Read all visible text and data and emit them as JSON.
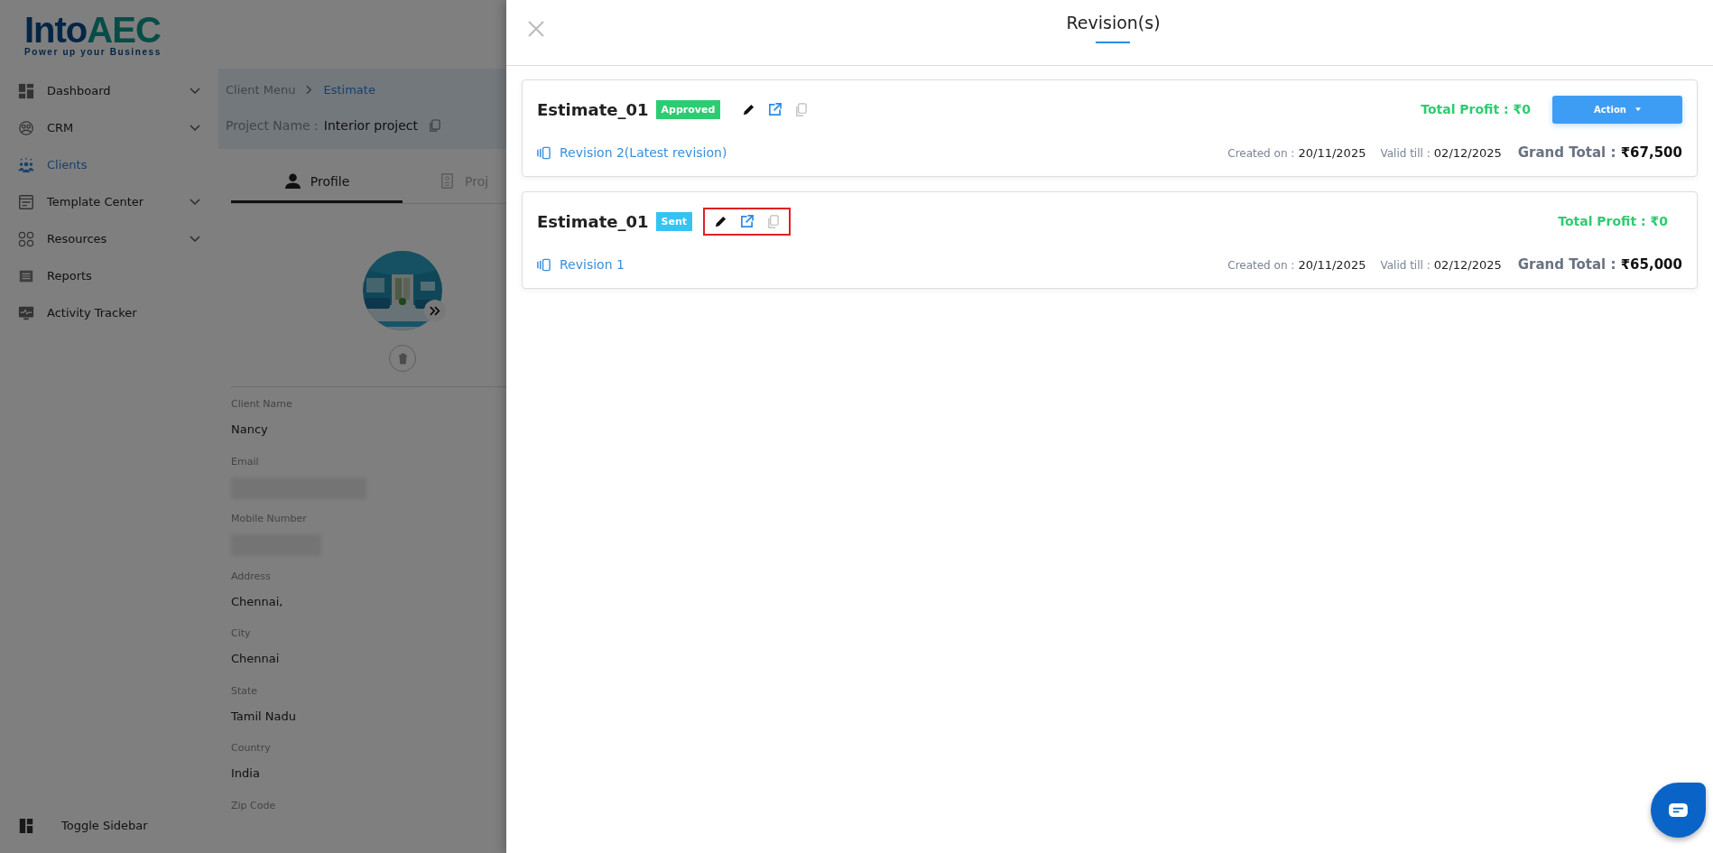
{
  "logo": {
    "name_main": "Into",
    "name_accent": "AEC",
    "tagline": "Power up your Business"
  },
  "sidebar": {
    "items": [
      {
        "label": "Dashboard",
        "expandable": true,
        "selected": false
      },
      {
        "label": "CRM",
        "expandable": true,
        "selected": false
      },
      {
        "label": "Clients",
        "expandable": false,
        "selected": true
      },
      {
        "label": "Template Center",
        "expandable": true,
        "selected": false
      },
      {
        "label": "Resources",
        "expandable": true,
        "selected": false
      },
      {
        "label": "Reports",
        "expandable": false,
        "selected": false
      },
      {
        "label": "Activity Tracker",
        "expandable": false,
        "selected": false
      }
    ],
    "toggle": "Toggle Sidebar"
  },
  "breadcrumb": [
    "Client Menu",
    "Estimate"
  ],
  "project": {
    "label": "Project Name :",
    "value": "Interior project"
  },
  "tabs": [
    {
      "label": "Profile",
      "selected": true
    },
    {
      "label": "Proj",
      "selected": false
    }
  ],
  "profile_fields": [
    {
      "label": "Client Name",
      "value": "Nancy",
      "kind": "text"
    },
    {
      "label": "Email",
      "kind": "redacted"
    },
    {
      "label": "Mobile Number",
      "kind": "redacted"
    },
    {
      "label": "Address",
      "value": "Chennai,",
      "kind": "text"
    },
    {
      "label": "City",
      "value": "Chennai",
      "kind": "text"
    },
    {
      "label": "State",
      "value": "Tamil Nadu",
      "kind": "text"
    },
    {
      "label": "Country",
      "value": "India",
      "kind": "text"
    },
    {
      "label": "Zip Code",
      "kind": "text"
    }
  ],
  "drawer": {
    "title": "Revision(s)",
    "revisions": [
      {
        "name": "Estimate_01",
        "status": {
          "label": "Approved",
          "kind": "approved"
        },
        "highlighted": false,
        "revision": "Revision 2(Latest revision)",
        "total_profit": "Total Profit : ₹0",
        "action": "Action",
        "created_label": "Created on :",
        "created_on": "20/11/2025",
        "valid_label": "Valid till :",
        "valid_till": "02/12/2025",
        "grand_label": "Grand Total :",
        "grand_total": "₹67,500"
      },
      {
        "name": "Estimate_01",
        "status": {
          "label": "Sent",
          "kind": "sent"
        },
        "highlighted": true,
        "revision": "Revision 1",
        "total_profit": "Total Profit : ₹0",
        "created_label": "Created on :",
        "created_on": "20/11/2025",
        "valid_label": "Valid till :",
        "valid_till": "02/12/2025",
        "grand_label": "Grand Total :",
        "grand_total": "₹65,000"
      }
    ]
  }
}
